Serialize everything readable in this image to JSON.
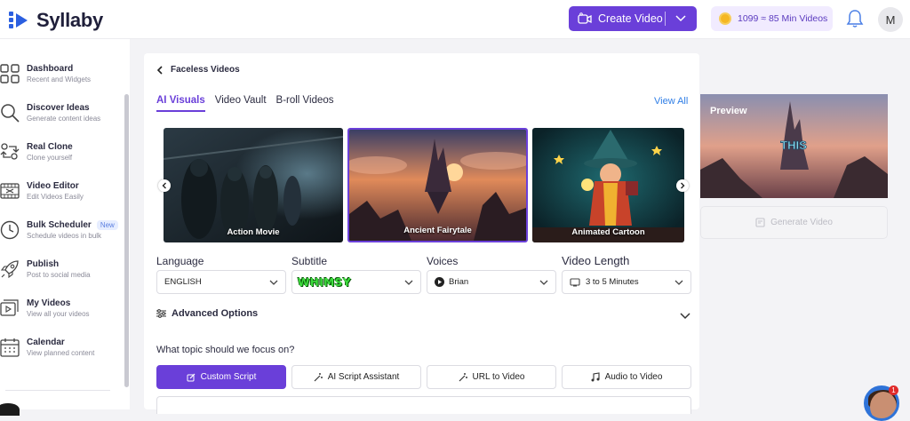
{
  "app": {
    "name": "Syllaby"
  },
  "header": {
    "create_label": "Create Video",
    "credits_text": "1099 ≈ 85 Min Videos",
    "avatar_initial": "M"
  },
  "sidebar": {
    "items": [
      {
        "title": "Dashboard",
        "subtitle": "Recent and Widgets"
      },
      {
        "title": "Discover Ideas",
        "subtitle": "Generate content ideas"
      },
      {
        "title": "Real Clone",
        "subtitle": "Clone yourself"
      },
      {
        "title": "Video Editor",
        "subtitle": "Edit Videos Easily"
      },
      {
        "title": "Bulk Scheduler",
        "subtitle": "Schedule videos in bulk",
        "badge": "New"
      },
      {
        "title": "Publish",
        "subtitle": "Post to social media"
      },
      {
        "title": "My Videos",
        "subtitle": "View all your videos"
      },
      {
        "title": "Calendar",
        "subtitle": "View planned content"
      }
    ]
  },
  "page": {
    "back_label": "Faceless Videos",
    "tabs": [
      "AI Visuals",
      "Video Vault",
      "B-roll Videos"
    ],
    "active_tab": "AI Visuals",
    "view_all": "View All",
    "styles": [
      {
        "caption": "Action Movie",
        "selected": false
      },
      {
        "caption": "Ancient Fairytale",
        "selected": true
      },
      {
        "caption": "Animated Cartoon",
        "selected": false
      }
    ],
    "preview": {
      "label": "Preview",
      "overlay_text": "THIS"
    },
    "generate_label": "Generate Video",
    "fields": {
      "language": {
        "label": "Language",
        "value": "ENGLISH"
      },
      "subtitle": {
        "label": "Subtitle",
        "value": "WHIMSY"
      },
      "voices": {
        "label": "Voices",
        "value": "Brian"
      },
      "length": {
        "label": "Video Length",
        "value": "3 to 5 Minutes"
      }
    },
    "advanced_label": "Advanced Options",
    "question": "What topic should we focus on?",
    "modes": [
      "Custom Script",
      "AI Script Assistant",
      "URL to Video",
      "Audio to Video"
    ],
    "active_mode": "Custom Script"
  },
  "chat": {
    "unread": "1"
  },
  "colors": {
    "accent": "#6a3fd9",
    "link": "#2f7ee6",
    "subtitle_green": "#3ddc3d"
  }
}
